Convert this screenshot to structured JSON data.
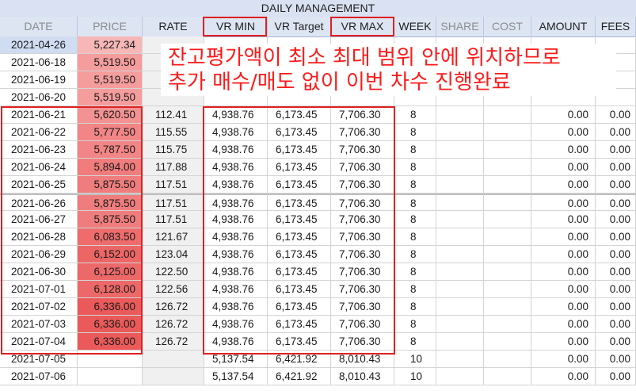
{
  "sheet": {
    "title": "DAILY MANAGEMENT"
  },
  "columns": {
    "date": "DATE",
    "price": "PRICE",
    "rate": "RATE",
    "vr_min": "VR MIN",
    "vr_target": "VR Target",
    "vr_max": "VR MAX",
    "week": "WEEK",
    "share": "SHARE",
    "cost": "COST",
    "amount": "AMOUNT",
    "fees": "FEES"
  },
  "rows": [
    {
      "date": "2021-04-26",
      "price": "5,227.34",
      "rate": "",
      "vr_min": "",
      "vr_target": "",
      "vr_max": "",
      "week": "",
      "amount": "",
      "fees": "",
      "price_shade": "#f7b7b7"
    },
    {
      "date": "2021-06-18",
      "price": "5,519.50",
      "rate": "",
      "vr_min": "",
      "vr_target": "",
      "vr_max": "",
      "week": "",
      "amount": "",
      "fees": "",
      "price_shade": "#f59d9d"
    },
    {
      "date": "2021-06-19",
      "price": "5,519.50",
      "rate": "",
      "vr_min": "",
      "vr_target": "",
      "vr_max": "",
      "week": "",
      "amount": "",
      "fees": "",
      "price_shade": "#f59d9d"
    },
    {
      "date": "2021-06-20",
      "price": "5,519.50",
      "rate": "",
      "vr_min": "",
      "vr_target": "",
      "vr_max": "",
      "week": "",
      "amount": "",
      "fees": "",
      "price_shade": "#f59d9d"
    },
    {
      "date": "2021-06-21",
      "price": "5,620.50",
      "rate": "112.41",
      "vr_min": "4,938.76",
      "vr_target": "6,173.45",
      "vr_max": "7,706.30",
      "week": "8",
      "amount": "0.00",
      "fees": "0.00",
      "price_shade": "#f39292"
    },
    {
      "date": "2021-06-22",
      "price": "5,777.50",
      "rate": "115.55",
      "vr_min": "4,938.76",
      "vr_target": "6,173.45",
      "vr_max": "7,706.30",
      "week": "8",
      "amount": "0.00",
      "fees": "0.00",
      "price_shade": "#f28686"
    },
    {
      "date": "2021-06-23",
      "price": "5,787.50",
      "rate": "115.75",
      "vr_min": "4,938.76",
      "vr_target": "6,173.45",
      "vr_max": "7,706.30",
      "week": "8",
      "amount": "0.00",
      "fees": "0.00",
      "price_shade": "#f28585"
    },
    {
      "date": "2021-06-24",
      "price": "5,894.00",
      "rate": "117.88",
      "vr_min": "4,938.76",
      "vr_target": "6,173.45",
      "vr_max": "7,706.30",
      "week": "8",
      "amount": "0.00",
      "fees": "0.00",
      "price_shade": "#f07c7c"
    },
    {
      "date": "2021-06-25",
      "price": "5,875.50",
      "rate": "117.51",
      "vr_min": "4,938.76",
      "vr_target": "6,173.45",
      "vr_max": "7,706.30",
      "week": "8",
      "amount": "0.00",
      "fees": "0.00",
      "price_shade": "#f07d7d"
    },
    {
      "date": "2021-06-26",
      "price": "5,875.50",
      "rate": "117.51",
      "vr_min": "4,938.76",
      "vr_target": "6,173.45",
      "vr_max": "7,706.30",
      "week": "8",
      "amount": "0.00",
      "fees": "0.00",
      "price_shade": "#f07d7d"
    },
    {
      "date": "2021-06-27",
      "price": "5,875.50",
      "rate": "117.51",
      "vr_min": "4,938.76",
      "vr_target": "6,173.45",
      "vr_max": "7,706.30",
      "week": "8",
      "amount": "0.00",
      "fees": "0.00",
      "price_shade": "#f07d7d"
    },
    {
      "date": "2021-06-28",
      "price": "6,083.50",
      "rate": "121.67",
      "vr_min": "4,938.76",
      "vr_target": "6,173.45",
      "vr_max": "7,706.30",
      "week": "8",
      "amount": "0.00",
      "fees": "0.00",
      "price_shade": "#ee6c6c"
    },
    {
      "date": "2021-06-29",
      "price": "6,152.00",
      "rate": "123.04",
      "vr_min": "4,938.76",
      "vr_target": "6,173.45",
      "vr_max": "7,706.30",
      "week": "8",
      "amount": "0.00",
      "fees": "0.00",
      "price_shade": "#ed6666"
    },
    {
      "date": "2021-06-30",
      "price": "6,125.00",
      "rate": "122.50",
      "vr_min": "4,938.76",
      "vr_target": "6,173.45",
      "vr_max": "7,706.30",
      "week": "8",
      "amount": "0.00",
      "fees": "0.00",
      "price_shade": "#ed6969"
    },
    {
      "date": "2021-07-01",
      "price": "6,128.00",
      "rate": "122.56",
      "vr_min": "4,938.76",
      "vr_target": "6,173.45",
      "vr_max": "7,706.30",
      "week": "8",
      "amount": "0.00",
      "fees": "0.00",
      "price_shade": "#ed6868"
    },
    {
      "date": "2021-07-02",
      "price": "6,336.00",
      "rate": "126.72",
      "vr_min": "4,938.76",
      "vr_target": "6,173.45",
      "vr_max": "7,706.30",
      "week": "8",
      "amount": "0.00",
      "fees": "0.00",
      "price_shade": "#eb5a5a"
    },
    {
      "date": "2021-07-03",
      "price": "6,336.00",
      "rate": "126.72",
      "vr_min": "4,938.76",
      "vr_target": "6,173.45",
      "vr_max": "7,706.30",
      "week": "8",
      "amount": "0.00",
      "fees": "0.00",
      "price_shade": "#eb5a5a"
    },
    {
      "date": "2021-07-04",
      "price": "6,336.00",
      "rate": "126.72",
      "vr_min": "4,938.76",
      "vr_target": "6,173.45",
      "vr_max": "7,706.30",
      "week": "8",
      "amount": "0.00",
      "fees": "0.00",
      "price_shade": "#eb5a5a"
    },
    {
      "date": "2021-07-05",
      "price": "",
      "rate": "",
      "vr_min": "5,137.54",
      "vr_target": "6,421.92",
      "vr_max": "8,010.43",
      "week": "10",
      "amount": "0.00",
      "fees": "0.00",
      "price_shade": ""
    },
    {
      "date": "2021-07-06",
      "price": "",
      "rate": "",
      "vr_min": "5,137.54",
      "vr_target": "6,421.92",
      "vr_max": "8,010.43",
      "week": "10",
      "amount": "0.00",
      "fees": "0.00",
      "price_shade": ""
    }
  ],
  "annotation": {
    "line1": "잔고평가액이 최소 최대 범위 안에 위치하므로",
    "line2": "추가 매수/매도 없이 이번 차수 진행완료"
  },
  "colors": {
    "highlight_border": "#e02020",
    "annotation_text": "#ff1a1a",
    "header_bg": "#dde5f3"
  }
}
